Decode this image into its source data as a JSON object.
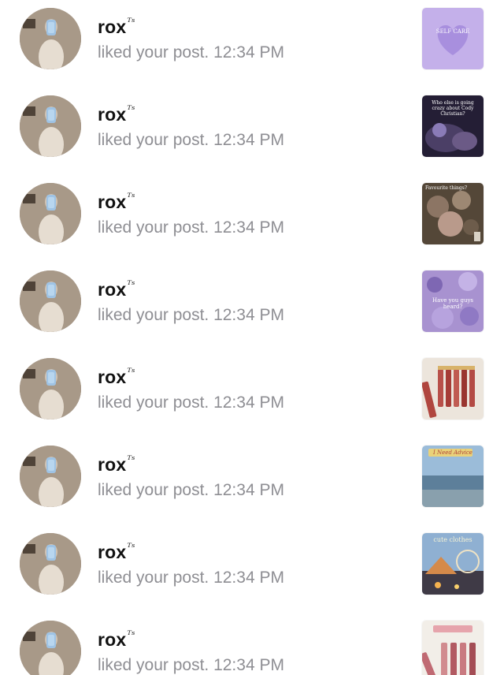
{
  "notifications": [
    {
      "username": "rox",
      "username_suffix": "ᵀˢ",
      "activity": "liked your post. 12:34 PM",
      "thumbnail": {
        "caption": "SELF CARE",
        "palette": [
          "#cbb6ec",
          "#a98bd8"
        ]
      }
    },
    {
      "username": "rox",
      "username_suffix": "ᵀˢ",
      "activity": "liked your post. 12:34 PM",
      "thumbnail": {
        "caption": "Who else is going crazy about Cody Christian?",
        "palette": [
          "#2a2340",
          "#6a5b8e"
        ]
      }
    },
    {
      "username": "rox",
      "username_suffix": "ᵀˢ",
      "activity": "liked your post. 12:34 PM",
      "thumbnail": {
        "caption": "Favourite things?",
        "palette": [
          "#5a4c3f",
          "#a58f7a"
        ]
      }
    },
    {
      "username": "rox",
      "username_suffix": "ᵀˢ",
      "activity": "liked your post. 12:34 PM",
      "thumbnail": {
        "caption": "Have you guys heard?",
        "palette": [
          "#9c86c9",
          "#c9b9e6"
        ]
      }
    },
    {
      "username": "rox",
      "username_suffix": "ᵀˢ",
      "activity": "liked your post. 12:34 PM",
      "thumbnail": {
        "caption": "",
        "palette": [
          "#e9e2d8",
          "#b3483f"
        ]
      }
    },
    {
      "username": "rox",
      "username_suffix": "ᵀˢ",
      "activity": "liked your post. 12:34 PM",
      "thumbnail": {
        "caption": "I Need Advice",
        "palette": [
          "#8ab0cf",
          "#5f7f98"
        ]
      }
    },
    {
      "username": "rox",
      "username_suffix": "ᵀˢ",
      "activity": "liked your post. 12:34 PM",
      "thumbnail": {
        "caption": "cute clothes",
        "palette": [
          "#7fa6cd",
          "#e7a868"
        ]
      }
    },
    {
      "username": "rox",
      "username_suffix": "ᵀˢ",
      "activity": "liked your post. 12:34 PM",
      "thumbnail": {
        "caption": "",
        "palette": [
          "#f2efe9",
          "#c06a73"
        ]
      }
    }
  ]
}
